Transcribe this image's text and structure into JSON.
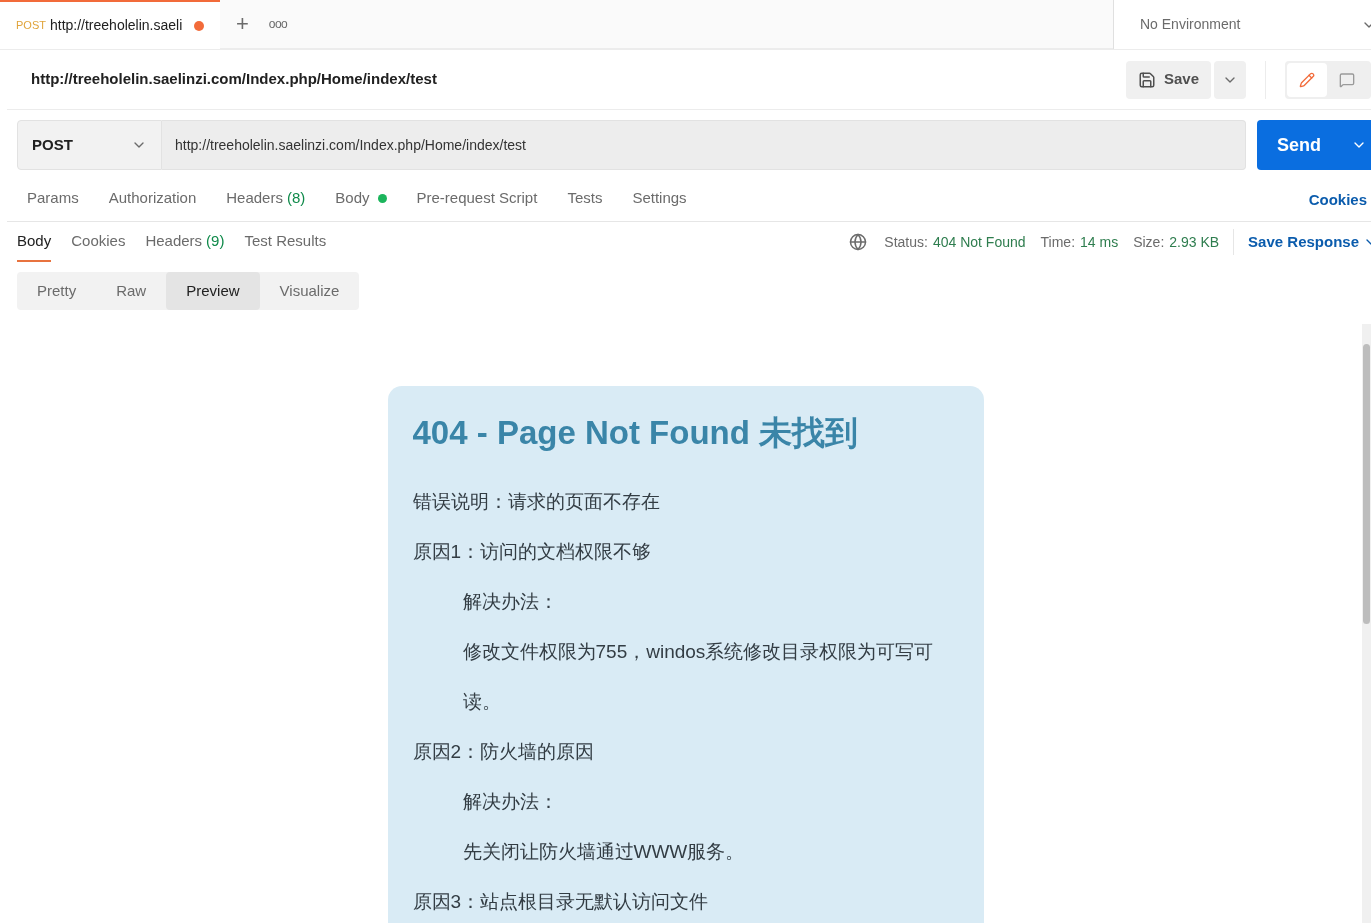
{
  "tab": {
    "method": "POST",
    "title": "http://treeholelin.saeli",
    "unsaved": true,
    "selected": true
  },
  "new_tab": "+",
  "more_tabs": "ooo",
  "environment": {
    "value": "No Environment"
  },
  "request_title": "http://treeholelin.saelinzi.com/Index.php/Home/index/test",
  "save_button": "Save",
  "request": {
    "method": "POST",
    "url": "http://treeholelin.saelinzi.com/Index.php/Home/index/test",
    "send": "Send"
  },
  "request_tabs": [
    {
      "label": "Params",
      "selected": false
    },
    {
      "label": "Authorization",
      "selected": false
    },
    {
      "label": "Headers",
      "count": "(8)",
      "selected": false
    },
    {
      "label": "Body",
      "dot": true,
      "selected": false
    },
    {
      "label": "Pre-request Script",
      "selected": false
    },
    {
      "label": "Tests",
      "selected": false
    },
    {
      "label": "Settings",
      "selected": false
    }
  ],
  "cookies_link": "Cookies",
  "response_tabs": [
    {
      "label": "Body",
      "selected": true
    },
    {
      "label": "Cookies",
      "selected": false
    },
    {
      "label": "Headers",
      "count": "(9)",
      "selected": false
    },
    {
      "label": "Test Results",
      "selected": false
    }
  ],
  "status": {
    "status_label": "Status:",
    "status_value": "404 Not Found",
    "time_label": "Time:",
    "time_value": "14 ms",
    "size_label": "Size:",
    "size_value": "2.93 KB"
  },
  "save_response": "Save Response",
  "view_modes": [
    {
      "label": "Pretty",
      "selected": false
    },
    {
      "label": "Raw",
      "selected": false
    },
    {
      "label": "Preview",
      "selected": true
    },
    {
      "label": "Visualize",
      "selected": false
    }
  ],
  "preview": {
    "heading": "404 - Page Not Found 未找到",
    "lines": [
      {
        "text": "错误说明：请求的页面不存在",
        "indented": false
      },
      {
        "text": "原因1：访问的文档权限不够",
        "indented": false
      },
      {
        "text": "解决办法：",
        "indented": true
      },
      {
        "text": "修改文件权限为755，windos系统修改目录权限为可写可读。",
        "indented": true
      },
      {
        "text": "原因2：防火墙的原因",
        "indented": false
      },
      {
        "text": "解决办法：",
        "indented": true
      },
      {
        "text": "先关闭让防火墙通过WWW服务。",
        "indented": true
      },
      {
        "text": "原因3：站点根目录无默认访问文件",
        "indented": false
      }
    ]
  }
}
